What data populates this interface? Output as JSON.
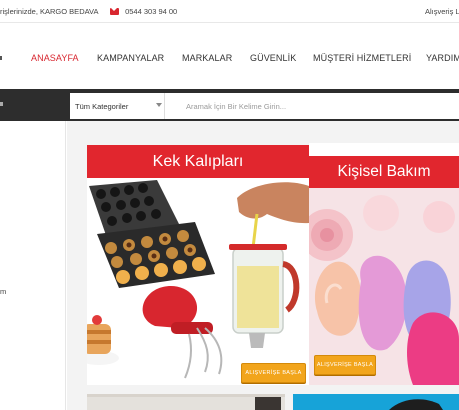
{
  "topbar": {
    "promo": "rişlerinizde, KARGO BEDAVA",
    "phone": "0544 303 94 00",
    "cart": "Alışveriş L"
  },
  "nav": {
    "items": [
      {
        "label": "ANASAYFA",
        "active": true
      },
      {
        "label": "KAMPANYALAR",
        "active": false
      },
      {
        "label": "MARKALAR",
        "active": false
      },
      {
        "label": "GÜVENLİK",
        "active": false
      },
      {
        "label": "MÜŞTERİ HİZMETLERİ",
        "active": false
      },
      {
        "label": "YARDIM",
        "active": false
      }
    ]
  },
  "search": {
    "category": "Tüm Kategoriler",
    "placeholder": "Aramak İçin Bir Kelime Girin..."
  },
  "sidebar": {
    "fragment": "m"
  },
  "banners": [
    {
      "title": "Kek Kalıpları",
      "cta": "ALIŞVERİŞE BAŞLA"
    },
    {
      "title": "Kişisel Bakım",
      "cta": "ALIŞVERİŞE BAŞLA"
    }
  ],
  "colors": {
    "accent": "#d8262f",
    "banner_red": "#e1262e",
    "cta_orange": "#f2a51c",
    "dark_bar": "#2d2d2d"
  },
  "icons": {
    "phone": "envelope-icon",
    "category_select": "chevron-down-icon"
  }
}
